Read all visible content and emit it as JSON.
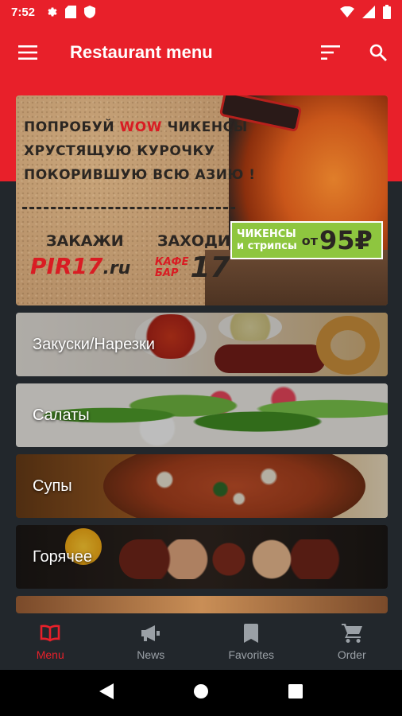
{
  "status_bar": {
    "time": "7:52",
    "bg_color": "#e8202a"
  },
  "app_bar": {
    "title": "Restaurant menu",
    "menu_icon": "hamburger-icon",
    "sort_icon": "sort-icon",
    "search_icon": "search-icon"
  },
  "banner": {
    "line1_prefix": "ПОПРОБУЙ",
    "line1_highlight": "WOW",
    "line1_suffix": "ЧИКЕНСЫ",
    "line2": "ХРУСТЯЩУЮ КУРОЧКУ",
    "line3": "ПОКОРИВШУЮ ВСЮ АЗИЮ !",
    "order_label": "ЗАКАЖИ",
    "visit_label": "ЗАХОДИ",
    "pir_logo": "PIR17",
    "pir_suffix": ".ru",
    "cafe_line1": "КАФЕ",
    "cafe_line2": "БАР",
    "cafe_number": "17",
    "price_line1": "ЧИКЕНСЫ",
    "price_line2": "и стрипсы",
    "price_from": "от",
    "price_value": "95₽"
  },
  "categories": [
    {
      "label": "Закуски/Нарезки"
    },
    {
      "label": "Салаты"
    },
    {
      "label": "Супы"
    },
    {
      "label": "Горячее"
    }
  ],
  "bottom_nav": [
    {
      "label": "Menu",
      "icon": "book-icon",
      "active": true
    },
    {
      "label": "News",
      "icon": "megaphone-icon",
      "active": false
    },
    {
      "label": "Favorites",
      "icon": "bookmark-icon",
      "active": false
    },
    {
      "label": "Order",
      "icon": "cart-icon",
      "active": false
    }
  ],
  "colors": {
    "accent": "#e8202a",
    "background": "#22272c",
    "nav_inactive": "#9aa0a6"
  }
}
